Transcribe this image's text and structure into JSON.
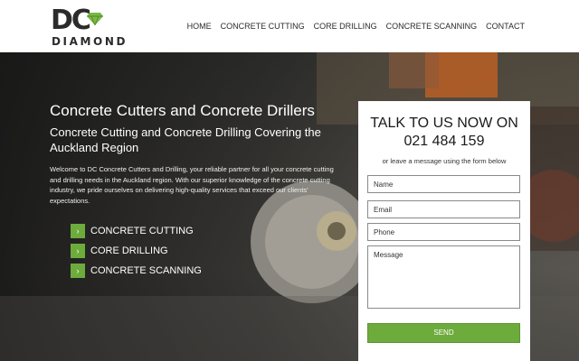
{
  "header": {
    "logo": {
      "mark": "DC",
      "word": "DIAMOND"
    },
    "nav": [
      "HOME",
      "CONCRETE CUTTING",
      "CORE DRILLING",
      "CONCRETE SCANNING",
      "CONTACT"
    ]
  },
  "hero": {
    "title": "Concrete Cutters and Concrete Drillers",
    "subtitle": "Concrete Cutting and Concrete Drilling Covering the Auckland Region",
    "intro": "Welcome to DC Concrete Cutters and Drilling, your reliable partner for all your concrete cutting and drilling needs in the Auckland region. With our superior knowledge of the concrete cutting industry, we pride ourselves on delivering high-quality services that exceed our clients' expectations.",
    "services": [
      "CONCRETE CUTTING",
      "CORE DRILLING",
      "CONCRETE SCANNING"
    ],
    "bullet_icon": "chevron-right-icon"
  },
  "form": {
    "title_line1": "TALK TO US NOW ON",
    "phone": "021 484 159",
    "subtitle": "or leave a message using the form below",
    "name_placeholder": "Name",
    "email_placeholder": "Email",
    "phone_placeholder": "Phone",
    "message_placeholder": "Message",
    "send_label": "SEND"
  },
  "colors": {
    "accent": "#6dab3c",
    "text_dark": "#2b2b2b"
  }
}
